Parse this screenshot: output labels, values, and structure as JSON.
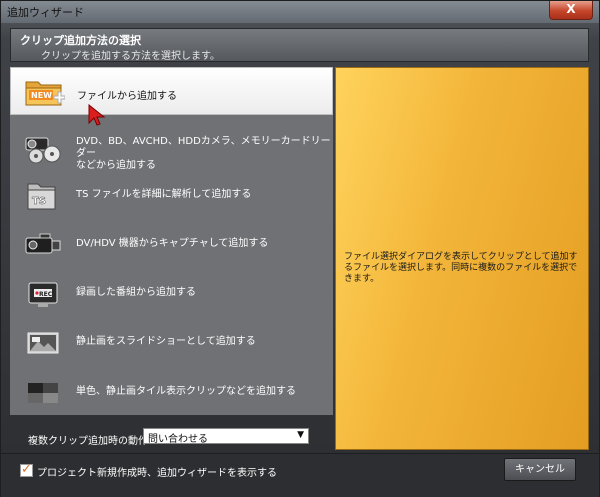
{
  "window": {
    "title": "追加ウィザード",
    "close_glyph": "X"
  },
  "header": {
    "title": "クリップ追加方法の選択",
    "subtitle": "クリップを追加する方法を選択します。"
  },
  "options": [
    {
      "label": "ファイルから追加する",
      "icon": "new-folder-icon",
      "selected": true
    },
    {
      "label": "DVD、BD、AVCHD、HDDカメラ、メモリーカードリーダー\nなどから追加する",
      "icon": "camera-disc-icon",
      "selected": false
    },
    {
      "label": "TS ファイルを詳細に解析して追加する",
      "icon": "ts-folder-icon",
      "selected": false
    },
    {
      "label": "DV/HDV 機器からキャプチャして追加する",
      "icon": "camcorder-icon",
      "selected": false
    },
    {
      "label": "録画した番組から追加する",
      "icon": "rec-tv-icon",
      "selected": false
    },
    {
      "label": "静止画をスライドショーとして追加する",
      "icon": "slideshow-icon",
      "selected": false
    },
    {
      "label": "単色、静止画タイル表示クリップなどを追加する",
      "icon": "color-tile-icon",
      "selected": false
    }
  ],
  "description": "ファイル選択ダイアログを表示してクリップとして追加するファイルを選択します。同時に複数のファイルを選択できます。",
  "multi_clip": {
    "label": "複数クリップ追加時の動作",
    "selected_value": "問い合わせる"
  },
  "footer": {
    "checkbox_label": "プロジェクト新規作成時、追加ウィザードを表示する",
    "checkbox_checked": true,
    "cancel_label": "キャンセル"
  },
  "colors": {
    "accent": "#f3b63a",
    "panel": "#6f7175",
    "checkmark": "#d9712a"
  }
}
